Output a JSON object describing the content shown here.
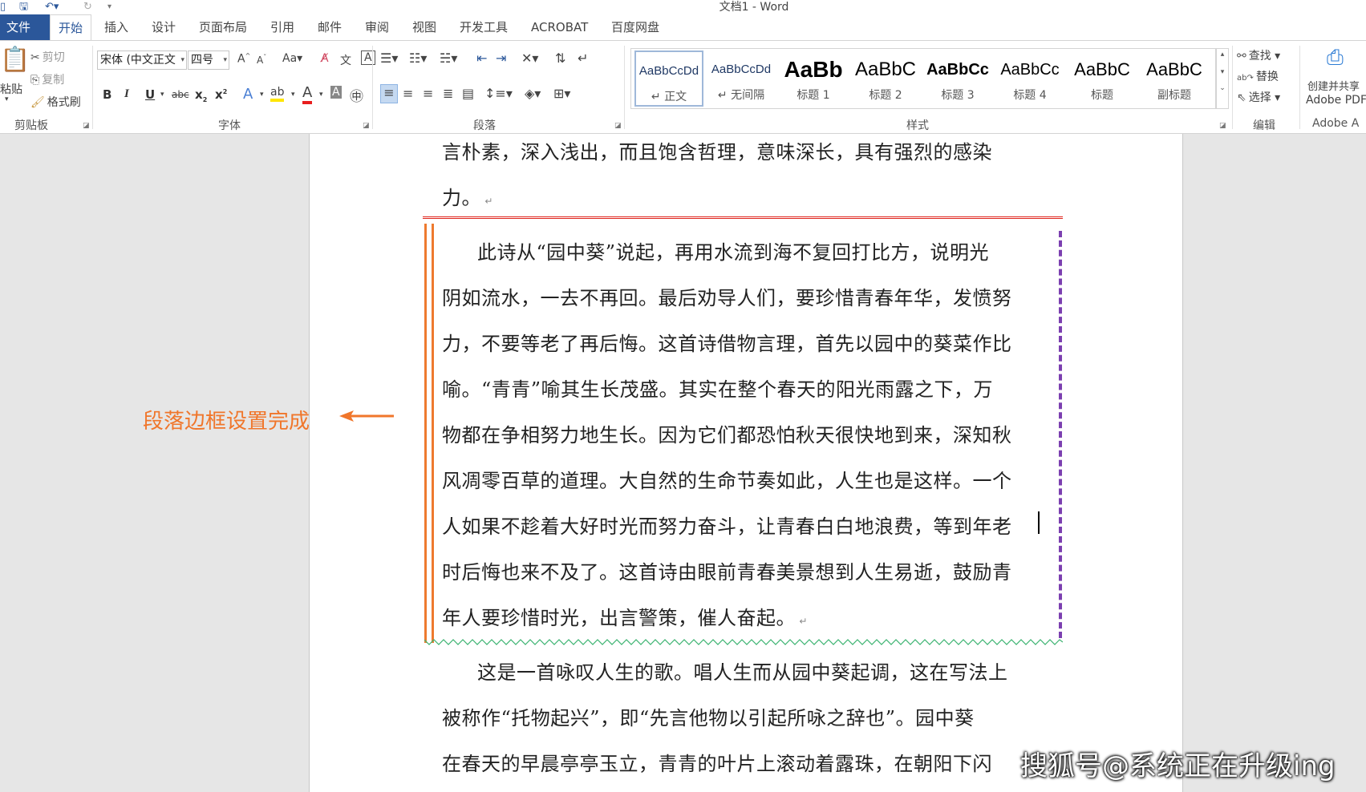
{
  "window": {
    "title": "文档1 - Word"
  },
  "tabs": [
    {
      "label": "文件"
    },
    {
      "label": "开始"
    },
    {
      "label": "插入"
    },
    {
      "label": "设计"
    },
    {
      "label": "页面布局"
    },
    {
      "label": "引用"
    },
    {
      "label": "邮件"
    },
    {
      "label": "审阅"
    },
    {
      "label": "视图"
    },
    {
      "label": "开发工具"
    },
    {
      "label": "ACROBAT"
    },
    {
      "label": "百度网盘"
    }
  ],
  "clipboard": {
    "paste": "粘贴",
    "cut": "剪切",
    "copy": "复制",
    "format_painter": "格式刷",
    "group": "剪贴板"
  },
  "font": {
    "name": "宋体 (中文正文",
    "size": "四号",
    "change_case": "Aa",
    "group": "字体"
  },
  "paragraph": {
    "group": "段落"
  },
  "styles": {
    "group": "样式",
    "items": [
      {
        "sample": "AaBbCcDd",
        "name": "↵ 正文"
      },
      {
        "sample": "AaBbCcDd",
        "name": "↵ 无间隔"
      },
      {
        "sample": "AaBb",
        "name": "标题 1"
      },
      {
        "sample": "AaBbC",
        "name": "标题 2"
      },
      {
        "sample": "AaBbCc",
        "name": "标题 3"
      },
      {
        "sample": "AaBbCc",
        "name": "标题 4"
      },
      {
        "sample": "AaBbC",
        "name": "标题"
      },
      {
        "sample": "AaBbC",
        "name": "副标题"
      }
    ]
  },
  "editing": {
    "find": "查找",
    "replace": "替换",
    "select": "选择",
    "group": "编辑"
  },
  "adobe": {
    "create_line1": "创建并共享",
    "create_line2": "Adobe PDF",
    "group": "Adobe A"
  },
  "document": {
    "lines": [
      "言朴素，深入浅出，而且饱含哲理，意味深长，具有强烈的感染",
      "力。",
      "此诗从“园中葵”说起，再用水流到海不复回打比方，说明光",
      "阴如流水，一去不再回。最后劝导人们，要珍惜青春年华，发愤努",
      "力，不要等老了再后悔。这首诗借物言理，首先以园中的葵菜作比",
      "喻。“青青”喻其生长茂盛。其实在整个春天的阳光雨露之下，万",
      "物都在争相努力地生长。因为它们都恐怕秋天很快地到来，深知秋",
      "风凋零百草的道理。大自然的生命节奏如此，人生也是这样。一个",
      "人如果不趁着大好时光而努力奋斗，让青春白白地浪费，等到年老",
      "时后悔也来不及了。这首诗由眼前青春美景想到人生易逝，鼓励青",
      "年人要珍惜时光，出言警策，催人奋起。",
      "这是一首咏叹人生的歌。唱人生而从园中葵起调，这在写法上",
      "被称作“托物起兴”，即“先言他物以引起所咏之辞也”。园中葵",
      "在春天的早晨亭亭玉立，青青的叶片上滚动着露珠，在朝阳下闪"
    ]
  },
  "annotation": "段落边框设置完成",
  "watermark": "搜狐号@系统正在升级ing",
  "colors": {
    "accent": "#2b579a",
    "annotation": "#f0762b",
    "border_top": "#e0261d",
    "border_left": "#ee7a2f",
    "border_right": "#7b3fb0",
    "border_bottom": "#3cb371"
  }
}
